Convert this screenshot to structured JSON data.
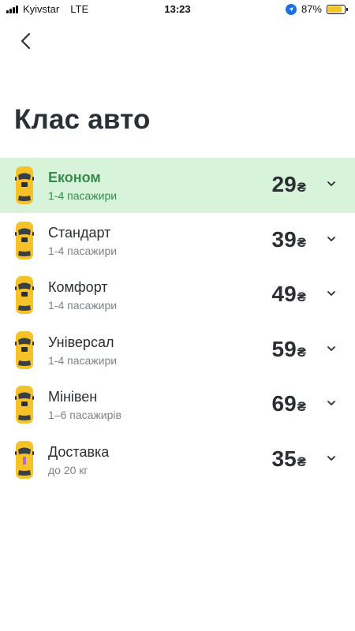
{
  "status_bar": {
    "carrier": "Kyivstar",
    "network": "LTE",
    "time": "13:23",
    "battery": "87%",
    "battery_level": 0.87,
    "battery_color": "#f3c525"
  },
  "header": {
    "back_icon": "chevron-left-icon",
    "title": "Клас авто"
  },
  "colors": {
    "selected_bg": "#d7f3da",
    "selected_text": "#3a8a4e",
    "car_yellow": "#f5c227"
  },
  "car_classes": [
    {
      "name": "Економ",
      "subtitle": "1-4 пасажири",
      "price": "29",
      "currency": "₴",
      "selected": true,
      "icon": "economy-car-icon"
    },
    {
      "name": "Стандарт",
      "subtitle": "1-4 пасажири",
      "price": "39",
      "currency": "₴",
      "selected": false,
      "icon": "standard-car-icon"
    },
    {
      "name": "Комфорт",
      "subtitle": "1-4 пасажири",
      "price": "49",
      "currency": "₴",
      "selected": false,
      "icon": "comfort-car-icon"
    },
    {
      "name": "Універсал",
      "subtitle": "1-4 пасажири",
      "price": "59",
      "currency": "₴",
      "selected": false,
      "icon": "wagon-car-icon"
    },
    {
      "name": "Мінівен",
      "subtitle": "1–6 пасажирів",
      "price": "69",
      "currency": "₴",
      "selected": false,
      "icon": "minivan-car-icon"
    },
    {
      "name": "Доставка",
      "subtitle": "до 20 кг",
      "price": "35",
      "currency": "₴",
      "selected": false,
      "icon": "delivery-car-icon"
    }
  ]
}
